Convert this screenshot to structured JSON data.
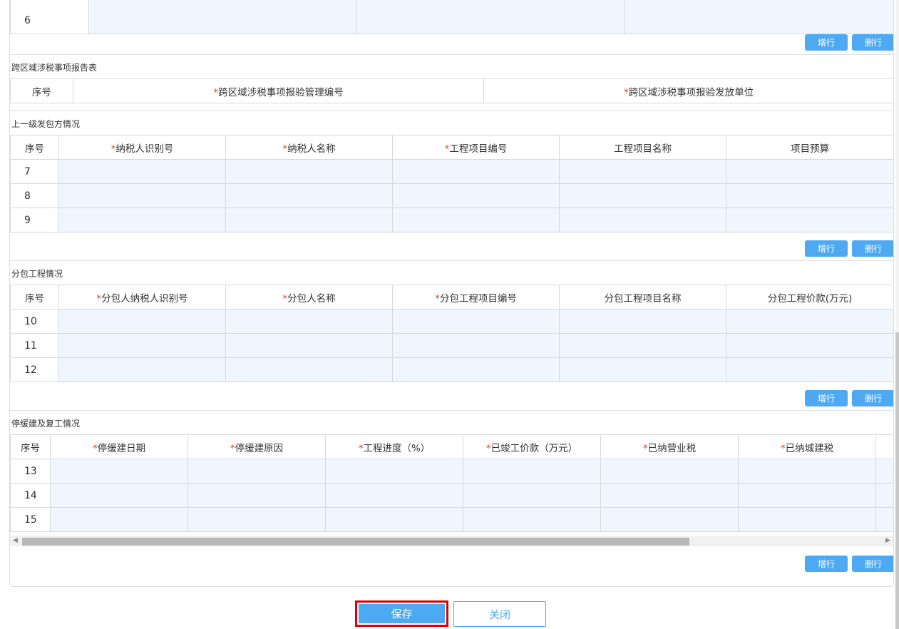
{
  "top_table": {
    "rows": [
      "6"
    ]
  },
  "buttons": {
    "add_row": "增行",
    "delete_row": "删行",
    "save": "保存",
    "close": "关闭"
  },
  "section_cross_region": {
    "title": "跨区域涉税事项报告表",
    "columns": [
      {
        "label": "序号",
        "required": false
      },
      {
        "label": "跨区域涉税事项报验管理编号",
        "required": true
      },
      {
        "label": "跨区域涉税事项报验发放单位",
        "required": true
      }
    ]
  },
  "section_upper_contractor": {
    "title": "上一级发包方情况",
    "columns": [
      {
        "label": "序号",
        "required": false
      },
      {
        "label": "纳税人识别号",
        "required": true
      },
      {
        "label": "纳税人名称",
        "required": true
      },
      {
        "label": "工程项目编号",
        "required": true
      },
      {
        "label": "工程项目名称",
        "required": false
      },
      {
        "label": "项目预算",
        "required": false
      }
    ],
    "rows": [
      "7",
      "8",
      "9"
    ]
  },
  "section_subcontract": {
    "title": "分包工程情况",
    "columns": [
      {
        "label": "序号",
        "required": false
      },
      {
        "label": "分包人纳税人识别号",
        "required": true
      },
      {
        "label": "分包人名称",
        "required": true
      },
      {
        "label": "分包工程项目编号",
        "required": true
      },
      {
        "label": "分包工程项目名称",
        "required": false
      },
      {
        "label": "分包工程价款(万元)",
        "required": false
      }
    ],
    "rows": [
      "10",
      "11",
      "12"
    ]
  },
  "section_suspension": {
    "title": "停缓建及复工情况",
    "columns": [
      {
        "label": "序号",
        "required": false
      },
      {
        "label": "停缓建日期",
        "required": true
      },
      {
        "label": "停缓建原因",
        "required": true
      },
      {
        "label": "工程进度（%）",
        "required": true
      },
      {
        "label": "已竣工价款（万元）",
        "required": true
      },
      {
        "label": "已纳营业税",
        "required": true
      },
      {
        "label": "已纳城建税",
        "required": true
      }
    ],
    "rows": [
      "13",
      "14",
      "15"
    ]
  },
  "required_mark": "*"
}
